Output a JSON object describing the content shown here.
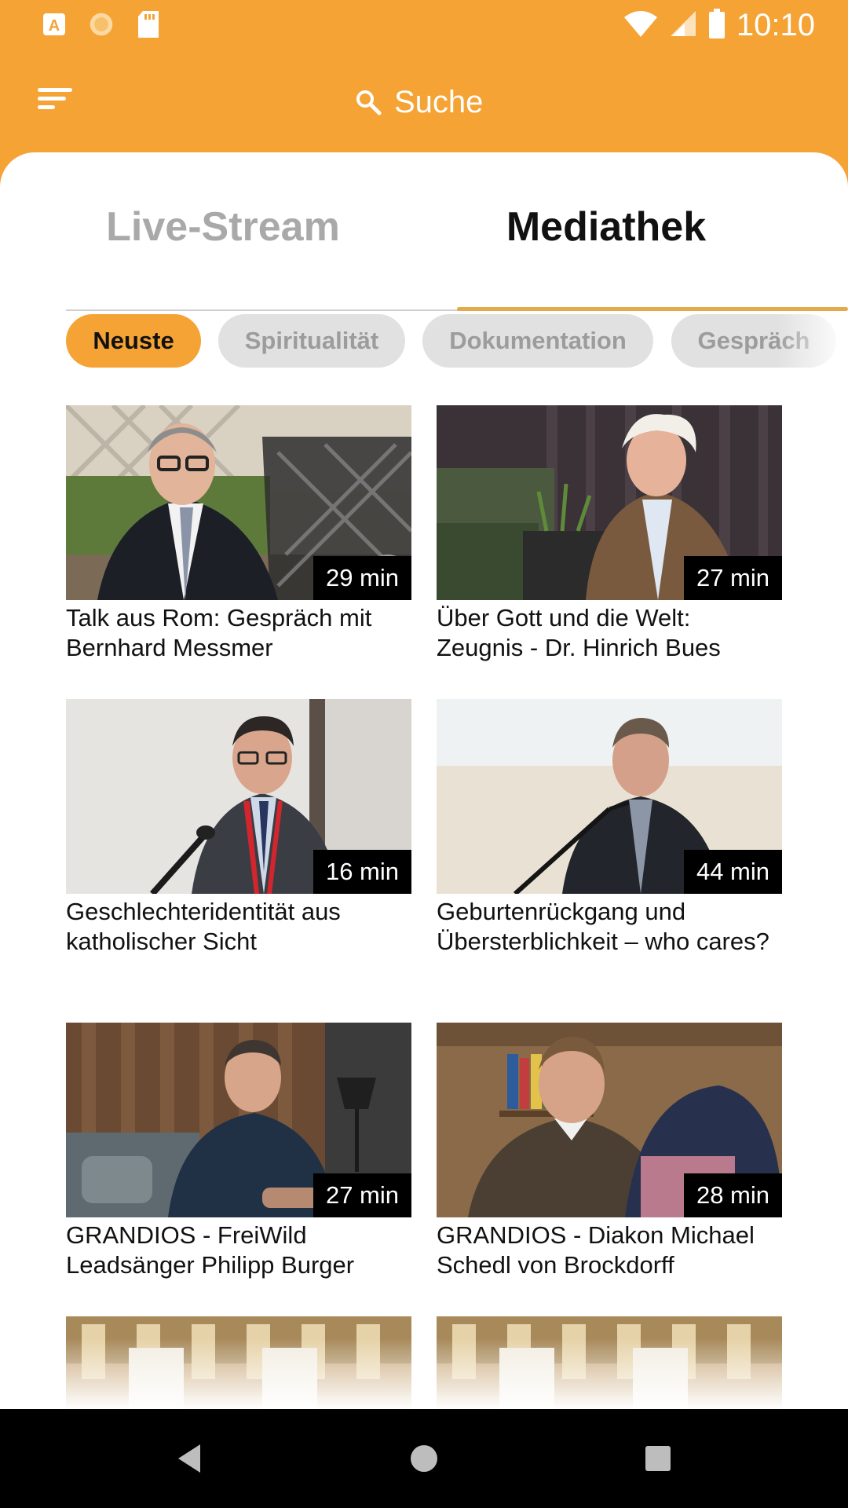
{
  "status_bar": {
    "time": "10:10",
    "left_icons": [
      "app-a-icon",
      "sun-icon",
      "sd-card-icon"
    ],
    "right_icons": [
      "wifi-icon",
      "signal-icon",
      "battery-icon"
    ]
  },
  "app_bar": {
    "menu_icon": "menu-icon",
    "search_icon": "search-icon",
    "search_label": "Suche"
  },
  "tabs": [
    {
      "label": "Live-Stream",
      "selected": false
    },
    {
      "label": "Mediathek",
      "selected": true
    }
  ],
  "filters": [
    {
      "label": "Neuste",
      "selected": true
    },
    {
      "label": "Spiritualität",
      "selected": false
    },
    {
      "label": "Dokumentation",
      "selected": false
    },
    {
      "label": "Gespräch",
      "selected": false
    }
  ],
  "videos": [
    {
      "title": "Talk aus Rom: Gespräch mit Bernhard Messmer",
      "duration": "29 min"
    },
    {
      "title": "Über Gott und die Welt: Zeugnis - Dr. Hinrich Bues",
      "duration": "27 min"
    },
    {
      "title": "Geschlechteridentität aus katholischer Sicht",
      "duration": "16 min"
    },
    {
      "title": "Geburtenrückgang und Übersterblichkeit – who cares?",
      "duration": "44 min"
    },
    {
      "title": "GRANDIOS - FreiWild Leadsänger Philipp Burger",
      "duration": "27 min"
    },
    {
      "title": "GRANDIOS - Diakon Michael Schedl von Brockdorff",
      "duration": "28 min"
    }
  ],
  "nav_bar": {
    "icons": [
      "back-icon",
      "home-icon",
      "recents-icon"
    ]
  },
  "colors": {
    "accent": "#f5a335",
    "tab_indicator": "#e4a94a",
    "chip_inactive": "#e1e1e1"
  }
}
